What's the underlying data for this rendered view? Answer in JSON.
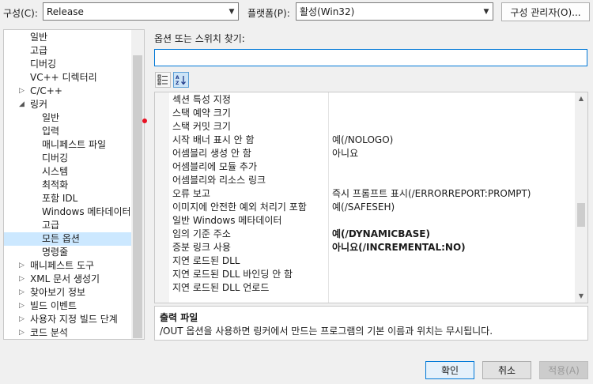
{
  "top": {
    "config_label": "구성(C):",
    "config_value": "Release",
    "platform_label": "플랫폼(P):",
    "platform_value": "활성(Win32)",
    "config_manager_label": "구성 관리자(O)..."
  },
  "tree": {
    "items": [
      {
        "label": "일반",
        "level": 1
      },
      {
        "label": "고급",
        "level": 1
      },
      {
        "label": "디버깅",
        "level": 1
      },
      {
        "label": "VC++ 디렉터리",
        "level": 1
      },
      {
        "label": "C/C++",
        "level": 0,
        "arrow": "▷"
      },
      {
        "label": "링커",
        "level": 0,
        "arrow": "◢"
      },
      {
        "label": "일반",
        "level": 2
      },
      {
        "label": "입력",
        "level": 2
      },
      {
        "label": "매니페스트 파일",
        "level": 2
      },
      {
        "label": "디버깅",
        "level": 2
      },
      {
        "label": "시스템",
        "level": 2
      },
      {
        "label": "최적화",
        "level": 2
      },
      {
        "label": "포함 IDL",
        "level": 2
      },
      {
        "label": "Windows 메타데이터",
        "level": 2
      },
      {
        "label": "고급",
        "level": 2
      },
      {
        "label": "모든 옵션",
        "level": 2,
        "selected": true
      },
      {
        "label": "명령줄",
        "level": 2
      },
      {
        "label": "매니페스트 도구",
        "level": 0,
        "arrow": "▷"
      },
      {
        "label": "XML 문서 생성기",
        "level": 0,
        "arrow": "▷"
      },
      {
        "label": "찾아보기 정보",
        "level": 0,
        "arrow": "▷"
      },
      {
        "label": "빌드 이벤트",
        "level": 0,
        "arrow": "▷"
      },
      {
        "label": "사용자 지정 빌드 단계",
        "level": 0,
        "arrow": "▷"
      },
      {
        "label": "코드 분석",
        "level": 0,
        "arrow": "▷"
      }
    ]
  },
  "search": {
    "label": "옵션 또는 스위치 찾기:",
    "value": ""
  },
  "grid": {
    "rows": [
      {
        "key": "섹션 특성 지정",
        "value": ""
      },
      {
        "key": "스택 예약 크기",
        "value": ""
      },
      {
        "key": "스택 커밋 크기",
        "value": ""
      },
      {
        "key": "시작 배너 표시 안 함",
        "value": "예(/NOLOGO)"
      },
      {
        "key": "어셈블리 생성 안 함",
        "value": "아니요"
      },
      {
        "key": "어셈블리에 모듈 추가",
        "value": ""
      },
      {
        "key": "어셈블리와 리소스 링크",
        "value": ""
      },
      {
        "key": "오류 보고",
        "value": "즉시 프롬프트 표시(/ERRORREPORT:PROMPT)"
      },
      {
        "key": "이미지에 안전한 예외 처리기 포함",
        "value": "예(/SAFESEH)"
      },
      {
        "key": "일반 Windows 메타데이터",
        "value": ""
      },
      {
        "key": "임의 기준 주소",
        "value": "예(/DYNAMICBASE)",
        "bold": true
      },
      {
        "key": "증분 링크 사용",
        "value": "아니요(/INCREMENTAL:NO)",
        "bold": true
      },
      {
        "key": "지연 로드된 DLL",
        "value": ""
      },
      {
        "key": "지연 로드된 DLL 바인딩 안 함",
        "value": ""
      },
      {
        "key": "지연 로드된 DLL 언로드",
        "value": ""
      }
    ]
  },
  "description": {
    "title": "출력 파일",
    "body": "/OUT 옵션을 사용하면 링커에서 만드는 프로그램의 기본 이름과 위치는 무시됩니다."
  },
  "buttons": {
    "ok": "확인",
    "cancel": "취소",
    "apply": "적용(A)"
  }
}
